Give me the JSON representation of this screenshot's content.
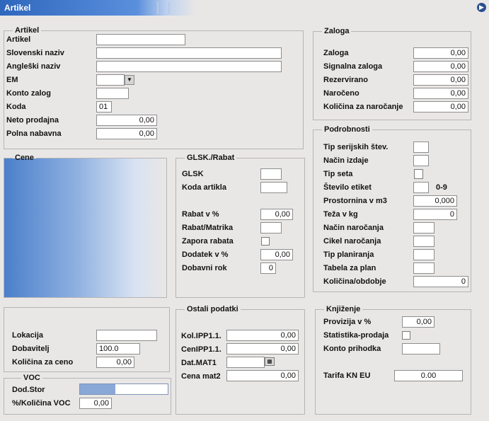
{
  "window": {
    "title": "Artikel"
  },
  "artikel": {
    "legend": "Artikel",
    "artikel_label": "Artikel",
    "artikel_value": "",
    "slo_label": "Slovenski naziv",
    "slo_value": "",
    "ang_label": "Angleški naziv",
    "ang_value": "",
    "em_label": "EM",
    "em_value": "",
    "konto_label": "Konto zalog",
    "konto_value": "",
    "koda_label": "Koda",
    "koda_value": "01",
    "neto_label": "Neto prodajna",
    "neto_value": "0,00",
    "polna_label": "Polna nabavna",
    "polna_value": "0,00"
  },
  "zaloga": {
    "legend": "Zaloga",
    "zaloga_label": "Zaloga",
    "zaloga_value": "0,00",
    "signalna_label": "Signalna zaloga",
    "signalna_value": "0,00",
    "rezervirano_label": "Rezervirano",
    "rezervirano_value": "0,00",
    "naroceno_label": "Naročeno",
    "naroceno_value": "0,00",
    "kolicina_label": "Količina za naročanje",
    "kolicina_value": "0,00"
  },
  "podrobnosti": {
    "legend": "Podrobnosti",
    "tip_ser_label": "Tip serijskih štev.",
    "tip_ser_value": "",
    "nacin_izdaje_label": "Način izdaje",
    "nacin_izdaje_value": "",
    "tip_seta_label": "Tip seta",
    "stevilo_label": "Število etiket",
    "stevilo_value": "",
    "stevilo_hint": "0-9",
    "prostornina_label": "Prostornina  v m3",
    "prostornina_value": "0,000",
    "teza_label": "Teža v  kg",
    "teza_value": "0",
    "nacin_nar_label": "Način naročanja",
    "nacin_nar_value": "",
    "cikel_label": "Cikel naročanja",
    "cikel_value": "",
    "tip_plan_label": "Tip planiranja",
    "tip_plan_value": "",
    "tabela_label": "Tabela za plan",
    "tabela_value": "",
    "kol_obd_label": "Količina/obdobje",
    "kol_obd_value": "0"
  },
  "cene": {
    "legend": "Cene"
  },
  "glsk": {
    "legend": "GLSK./Rabat",
    "glsk_label": "GLSK",
    "glsk_value": "",
    "koda_art_label": "Koda artikla",
    "koda_art_value": "",
    "rabat_label": "Rabat v %",
    "rabat_value": "0,00",
    "matrika_label": "Rabat/Matrika",
    "matrika_value": "",
    "zapora_label": "Zapora rabata",
    "dodatek_label": "Dodatek v %",
    "dodatek_value": "0,00",
    "dobavni_label": "Dobavni rok",
    "dobavni_value": "0"
  },
  "lokacija": {
    "lokacija_label": "Lokacija",
    "lokacija_value": "",
    "dobavitelj_label": "Dobavitelj",
    "dobavitelj_value": "100.0",
    "kolicina_ceno_label": "Količina za ceno",
    "kolicina_ceno_value": "0,00"
  },
  "voc": {
    "legend": "VOC",
    "dod_stor_label": "Dod.Stor",
    "dod_stor_fill": 0.4,
    "kol_voc_label": "%/Količina VOC",
    "kol_voc_value": "0,00"
  },
  "ostali": {
    "legend": "Ostali podatki",
    "ipp1_label": "Kol.IPP1.1.",
    "ipp1_value": "0,00",
    "cenipp_label": "CenIPP1.1.",
    "cenipp_value": "0,00",
    "mat1_label": "Dat.MAT1",
    "mat1_value": "",
    "mat2_label": "Cena mat2",
    "mat2_value": "0,00"
  },
  "knjizenje": {
    "legend": "Knjiženje",
    "provizija_label": "Provizija v %",
    "provizija_value": "0,00",
    "statistika_label": "Statistika-prodaja",
    "konto_prih_label": "Konto prihodka",
    "konto_prih_value": "",
    "tarifa_label": "Tarifa KN EU",
    "tarifa_value": "0.00"
  },
  "icons": {
    "nav": "arrow-right-icon",
    "dropdown": "chevron-down-icon",
    "calendar": "calendar-icon"
  }
}
